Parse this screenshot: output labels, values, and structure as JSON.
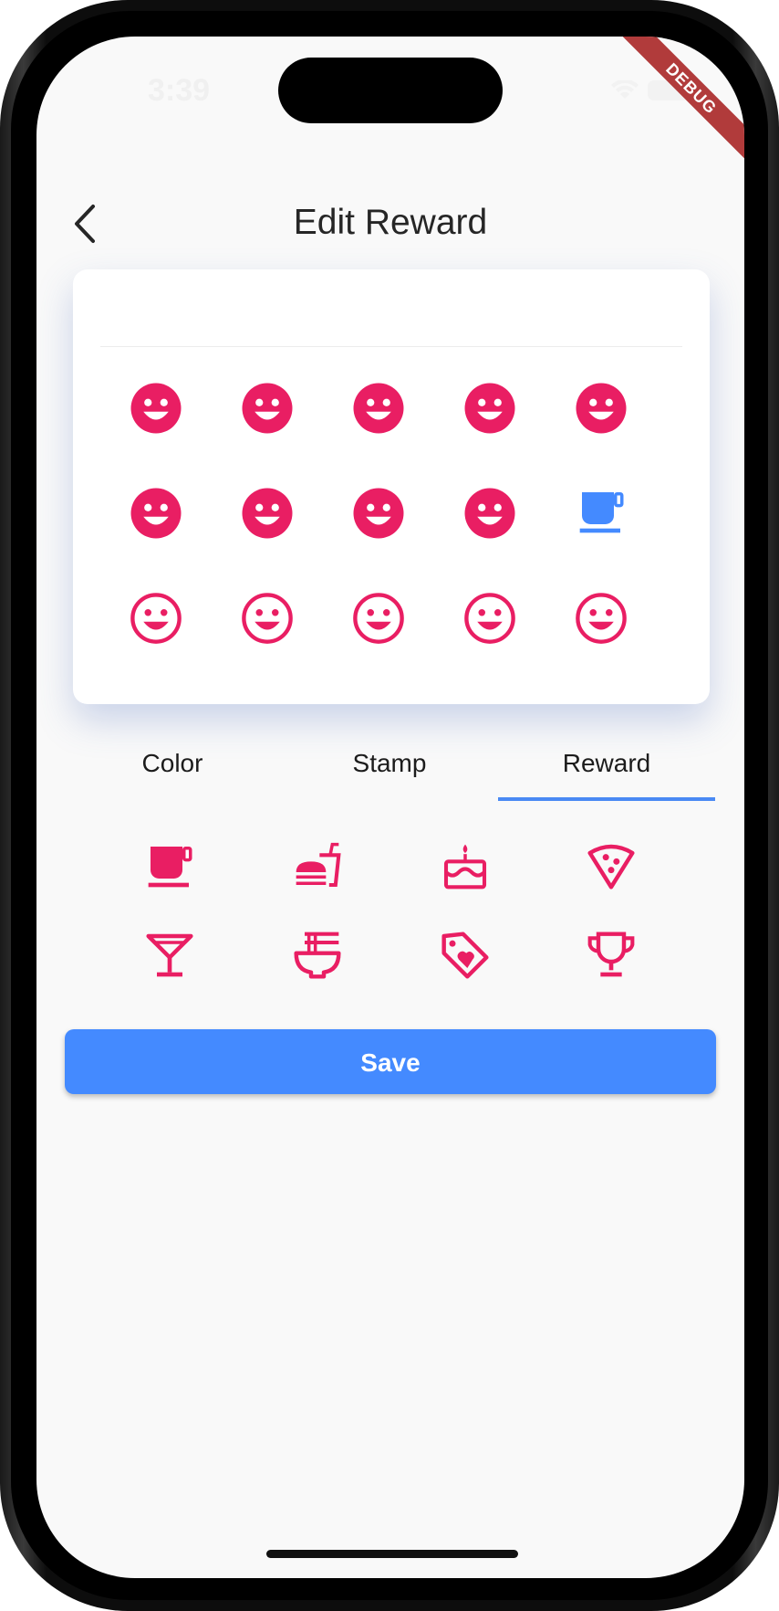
{
  "status_bar": {
    "time": "3:39",
    "wifi_icon": "wifi-icon",
    "battery_icon": "battery-icon"
  },
  "debug_banner": "DEBUG",
  "header": {
    "title": "Edit Reward",
    "back_icon": "arrow-back-icon"
  },
  "stamp_card": {
    "rows": [
      [
        "filled-smiley-icon",
        "filled-smiley-icon",
        "filled-smiley-icon",
        "filled-smiley-icon",
        "filled-smiley-icon"
      ],
      [
        "filled-smiley-icon",
        "filled-smiley-icon",
        "filled-smiley-icon",
        "filled-smiley-icon",
        "coffee-cup-icon"
      ],
      [
        "outline-smiley-icon",
        "outline-smiley-icon",
        "outline-smiley-icon",
        "outline-smiley-icon",
        "outline-smiley-icon"
      ]
    ],
    "stamp_color": "#e91e63",
    "reward_color": "#448aff"
  },
  "tabs": [
    {
      "label": "Color",
      "selected": false
    },
    {
      "label": "Stamp",
      "selected": false
    },
    {
      "label": "Reward",
      "selected": true
    }
  ],
  "reward_icons": [
    "coffee-cup-icon",
    "fastfood-icon",
    "cake-icon",
    "pizza-icon",
    "cocktail-icon",
    "ramen-bowl-icon",
    "tag-heart-icon",
    "trophy-icon"
  ],
  "save_button": {
    "label": "Save"
  },
  "colors": {
    "accent": "#448aff",
    "icon": "#e91e63",
    "background": "#f9f9f9"
  }
}
